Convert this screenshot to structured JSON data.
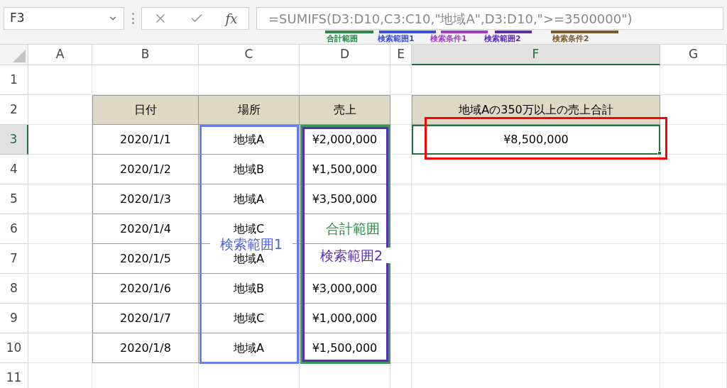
{
  "name_box": {
    "value": "F3"
  },
  "formula_bar": {
    "fx": "fx",
    "formula": "=SUMIFS(D3:D10,C3:C10,\"地域A\",D3:D10,\">=3500000\")"
  },
  "formula_annotations": [
    {
      "label": "合計範囲",
      "color": "#2e8b47"
    },
    {
      "label": "検索範囲1",
      "color": "#3b4ee0"
    },
    {
      "label": "検索条件1",
      "color": "#a23cc8"
    },
    {
      "label": "検索範囲2",
      "color": "#5a2db5"
    },
    {
      "label": "検索条件2",
      "color": "#7a5a2e"
    }
  ],
  "columns": [
    {
      "label": "A",
      "selected": false
    },
    {
      "label": "B",
      "selected": false
    },
    {
      "label": "C",
      "selected": false
    },
    {
      "label": "D",
      "selected": false
    },
    {
      "label": "E",
      "selected": false
    },
    {
      "label": "F",
      "selected": true
    },
    {
      "label": "G",
      "selected": false
    }
  ],
  "row_numbers": [
    {
      "label": "1",
      "selected": false
    },
    {
      "label": "2",
      "selected": false
    },
    {
      "label": "3",
      "selected": true
    },
    {
      "label": "4",
      "selected": false
    },
    {
      "label": "5",
      "selected": false
    },
    {
      "label": "6",
      "selected": false
    },
    {
      "label": "7",
      "selected": false
    },
    {
      "label": "8",
      "selected": false
    },
    {
      "label": "9",
      "selected": false
    },
    {
      "label": "10",
      "selected": false
    },
    {
      "label": "11",
      "selected": false
    }
  ],
  "table": {
    "headers": [
      "日付",
      "場所",
      "売上"
    ],
    "rows": [
      [
        "2020/1/1",
        "地域A",
        "¥2,000,000"
      ],
      [
        "2020/1/2",
        "地域B",
        "¥1,500,000"
      ],
      [
        "2020/1/3",
        "地域A",
        "¥3,500,000"
      ],
      [
        "2020/1/4",
        "地域C",
        ""
      ],
      [
        "2020/1/5",
        "地域A",
        ""
      ],
      [
        "2020/1/6",
        "地域B",
        "¥3,000,000"
      ],
      [
        "2020/1/7",
        "地域C",
        "¥1,000,000"
      ],
      [
        "2020/1/8",
        "地域A",
        "¥1,500,000"
      ]
    ]
  },
  "result": {
    "heading": "地域Aの350万以上の売上合計",
    "value": "¥8,500,000"
  },
  "callouts": [
    {
      "label": "検索範囲1",
      "color": "#4a5fe6"
    },
    {
      "label": "合計範囲",
      "color": "#2e8b47"
    },
    {
      "label": "検索範囲2",
      "color": "#5a2db5"
    }
  ]
}
